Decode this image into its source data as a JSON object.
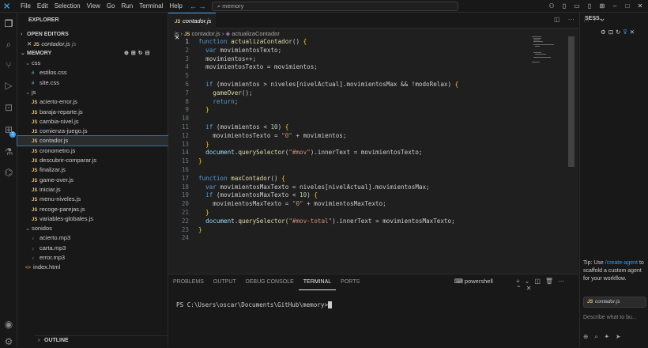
{
  "titlebar": {
    "menu": [
      "File",
      "Edit",
      "Selection",
      "View",
      "Go",
      "Run",
      "Terminal",
      "Help"
    ],
    "nav": "←  →",
    "search": "memory"
  },
  "sidebar": {
    "title": "EXPLORER",
    "open_editors": "OPEN EDITORS",
    "open_file": {
      "name": "contador.js",
      "dir": "js"
    },
    "root": "MEMORY",
    "items": [
      {
        "label": "css",
        "type": "folder",
        "depth": 1
      },
      {
        "label": "estilos.css",
        "type": "css",
        "depth": 2
      },
      {
        "label": "site.css",
        "type": "css",
        "depth": 2
      },
      {
        "label": "js",
        "type": "folder",
        "depth": 1
      },
      {
        "label": "acierto-error.js",
        "type": "js",
        "depth": 2
      },
      {
        "label": "baraja-reparte.js",
        "type": "js",
        "depth": 2
      },
      {
        "label": "cambia-nivel.js",
        "type": "js",
        "depth": 2
      },
      {
        "label": "comienza-juego.js",
        "type": "js",
        "depth": 2
      },
      {
        "label": "contador.js",
        "type": "js",
        "depth": 2,
        "selected": true
      },
      {
        "label": "cronometro.js",
        "type": "js",
        "depth": 2
      },
      {
        "label": "descubrir-comparar.js",
        "type": "js",
        "depth": 2
      },
      {
        "label": "finalizar.js",
        "type": "js",
        "depth": 2
      },
      {
        "label": "game-over.js",
        "type": "js",
        "depth": 2
      },
      {
        "label": "iniciar.js",
        "type": "js",
        "depth": 2
      },
      {
        "label": "menu-niveles.js",
        "type": "js",
        "depth": 2
      },
      {
        "label": "recoge-parejas.js",
        "type": "js",
        "depth": 2
      },
      {
        "label": "variables-globales.js",
        "type": "js",
        "depth": 2
      },
      {
        "label": "sonidos",
        "type": "folder",
        "depth": 1
      },
      {
        "label": "acierto.mp3",
        "type": "mp3",
        "depth": 2
      },
      {
        "label": "carta.mp3",
        "type": "mp3",
        "depth": 2
      },
      {
        "label": "error.mp3",
        "type": "mp3",
        "depth": 2
      },
      {
        "label": "index.html",
        "type": "html",
        "depth": 1
      }
    ],
    "outline": "OUTLINE"
  },
  "editor": {
    "tab": "contador.js",
    "breadcrumb": [
      "js",
      "contador.js",
      "actualizaContador"
    ],
    "lines": [
      "function actualizaContador() {",
      "  var movimientosTexto;",
      "  movimientos++;",
      "  movimientosTexto = movimientos;",
      "",
      "  if (movimientos > niveles[nivelActual].movimientosMax && !modoRelax) {",
      "    gameOver();",
      "    return;",
      "  }",
      "",
      "  if (movimientos < 10) {",
      "    movimientosTexto = \"0\" + movimientos;",
      "  }",
      "  document.querySelector(\"#mov\").innerText = movimientosTexto;",
      "}",
      "",
      "function maxContador() {",
      "  var movimientosMaxTexto = niveles[nivelActual].movimientosMax;",
      "  if (movimientosMaxTexto < 10) {",
      "    movimientosMaxTexto = \"0\" + movimientosMaxTexto;",
      "  }",
      "  document.querySelector(\"#mov-total\").innerText = movimientosMaxTexto;",
      "}",
      ""
    ]
  },
  "panel": {
    "tabs": [
      "PROBLEMS",
      "OUTPUT",
      "DEBUG CONSOLE",
      "TERMINAL",
      "PORTS"
    ],
    "active": "TERMINAL",
    "shell": "powershell",
    "prompt": "PS C:\\Users\\oscar\\Documents\\GitHub\\memory>"
  },
  "chat": {
    "title": "SESS...",
    "tip_prefix": "Tip: Use ",
    "tip_cmd": "/create-agent",
    "tip_rest": " to scaffold a custom agent for your workflow.",
    "context_file": "contador.js",
    "input_placeholder": "Describe what to bu..."
  }
}
